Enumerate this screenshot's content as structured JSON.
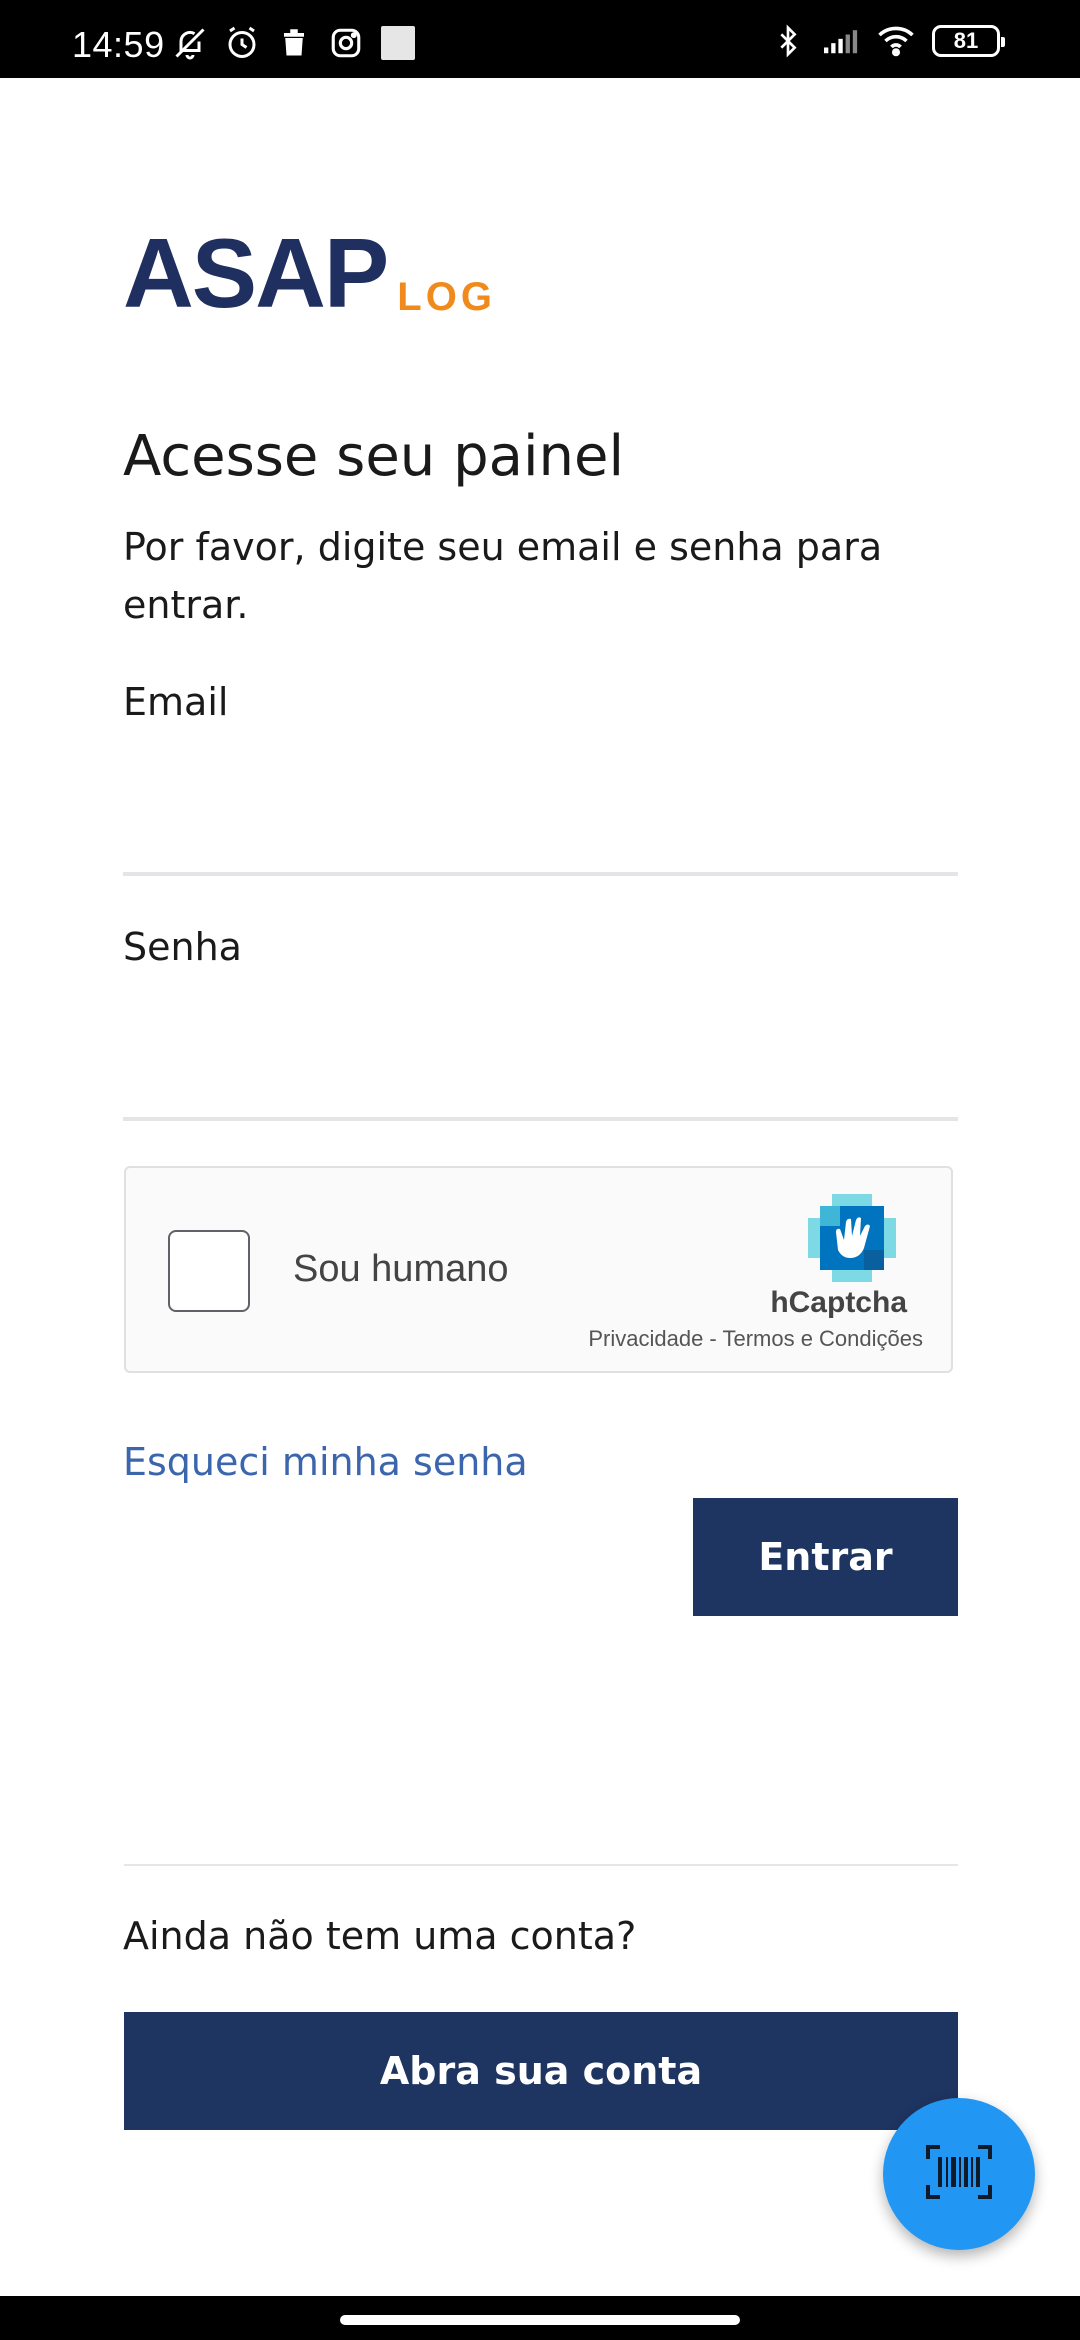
{
  "status_bar": {
    "time": "14:59",
    "battery": "81",
    "left_icons": [
      "bell-off-icon",
      "alarm-icon",
      "trash-icon",
      "instagram-icon",
      "gallery-icon"
    ],
    "right_icons": [
      "bluetooth-icon",
      "signal-icon",
      "wifi-icon",
      "battery-icon"
    ]
  },
  "logo": {
    "main": "ASAP",
    "sub": "LOG",
    "colors": {
      "main": "#1f2f5f",
      "sub": "#f08a1c"
    }
  },
  "page": {
    "title": "Acesse seu painel",
    "subtitle": "Por favor, digite seu email e senha para entrar."
  },
  "form": {
    "email_label": "Email",
    "email_value": "",
    "password_label": "Senha",
    "password_value": ""
  },
  "captcha": {
    "label": "Sou humano",
    "brand": "hCaptcha",
    "links": "Privacidade - Termos e Condições"
  },
  "actions": {
    "forgot_password": "Esqueci minha senha",
    "enter_button": "Entrar",
    "no_account_text": "Ainda não tem uma conta?",
    "open_account_button": "Abra sua conta"
  },
  "fab": {
    "icon": "barcode-scan-icon"
  },
  "colors": {
    "primary": "#1e3561",
    "link": "#3b66ad",
    "fab": "#2196f3"
  }
}
